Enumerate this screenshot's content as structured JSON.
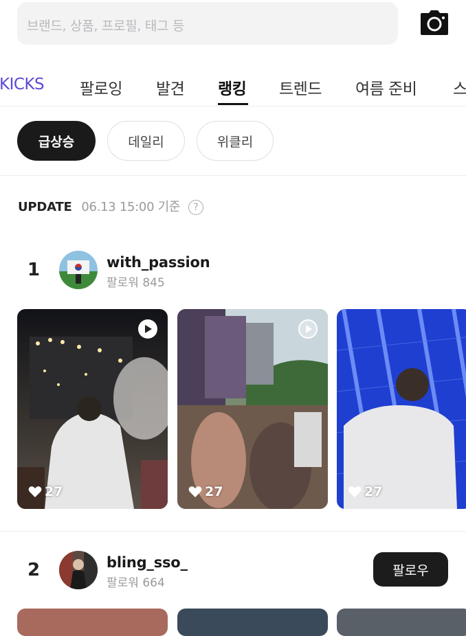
{
  "search": {
    "placeholder": "브랜드, 상품, 프로필, 태그 등"
  },
  "tabs": [
    {
      "label": "KICKS"
    },
    {
      "label": "팔로잉"
    },
    {
      "label": "발견"
    },
    {
      "label": "랭킹"
    },
    {
      "label": "트렌드"
    },
    {
      "label": "여름 준비"
    },
    {
      "label": "스"
    }
  ],
  "filters": [
    {
      "label": "급상승"
    },
    {
      "label": "데일리"
    },
    {
      "label": "위클리"
    }
  ],
  "update": {
    "label": "UPDATE",
    "time": "06.13 15:00 기준",
    "help": "?"
  },
  "rankings": [
    {
      "rank": "1",
      "username": "with_passion",
      "followers": "팔로워 845",
      "posts": [
        {
          "likes": "27"
        },
        {
          "likes": "27"
        },
        {
          "likes": "27"
        }
      ]
    },
    {
      "rank": "2",
      "username": "bling_sso_",
      "followers": "팔로워 664",
      "follow_label": "팔로우"
    }
  ],
  "colors": {
    "accent": "#5b49d6",
    "dark": "#1a1a1a"
  }
}
